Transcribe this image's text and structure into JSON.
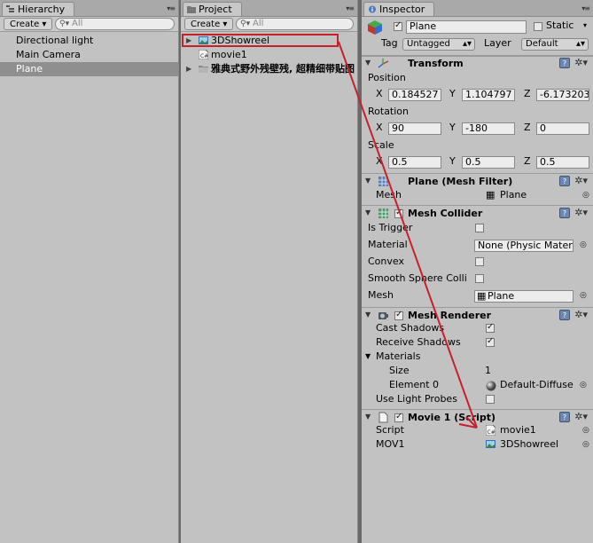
{
  "hierarchy": {
    "tab_label": "Hierarchy",
    "create_label": "Create ▾",
    "search_placeholder": "All",
    "items": [
      "Directional light",
      "Main Camera",
      "Plane"
    ],
    "selected": "Plane"
  },
  "project": {
    "tab_label": "Project",
    "create_label": "Create ▾",
    "search_placeholder": "All",
    "items": [
      "3DShowreel",
      "movie1",
      "雅典式野外残壁残, 超精细带贴图"
    ]
  },
  "inspector": {
    "tab_label": "Inspector",
    "object_name": "Plane",
    "static_label": "Static",
    "tag_label": "Tag",
    "tag_value": "Untagged",
    "layer_label": "Layer",
    "layer_value": "Default",
    "transform": {
      "title": "Transform",
      "position_label": "Position",
      "position": {
        "x": "0.184527",
        "y": "1.104797",
        "z": "-6.173203"
      },
      "rotation_label": "Rotation",
      "rotation": {
        "x": "90",
        "y": "-180",
        "z": "0"
      },
      "scale_label": "Scale",
      "scale": {
        "x": "0.5",
        "y": "0.5",
        "z": "0.5"
      },
      "x_label": "X",
      "y_label": "Y",
      "z_label": "Z"
    },
    "mesh_filter": {
      "title": "Plane (Mesh Filter)",
      "mesh_label": "Mesh",
      "mesh_value": "Plane"
    },
    "mesh_collider": {
      "title": "Mesh Collider",
      "is_trigger_label": "Is Trigger",
      "material_label": "Material",
      "material_value": "None (Physic Mater",
      "convex_label": "Convex",
      "smooth_label": "Smooth Sphere Colli",
      "mesh_label": "Mesh",
      "mesh_value": "Plane"
    },
    "mesh_renderer": {
      "title": "Mesh Renderer",
      "cast_label": "Cast Shadows",
      "receive_label": "Receive Shadows",
      "materials_label": "Materials",
      "size_label": "Size",
      "size_value": "1",
      "element_label": "Element 0",
      "element_value": "Default-Diffuse",
      "probes_label": "Use Light Probes"
    },
    "script": {
      "title": "Movie 1 (Script)",
      "script_label": "Script",
      "script_value": "movie1",
      "mov_label": "MOV1",
      "mov_value": "3DShowreel"
    }
  },
  "colors": {
    "annotation": "#c8202a",
    "selection": "#8f8f8f"
  }
}
